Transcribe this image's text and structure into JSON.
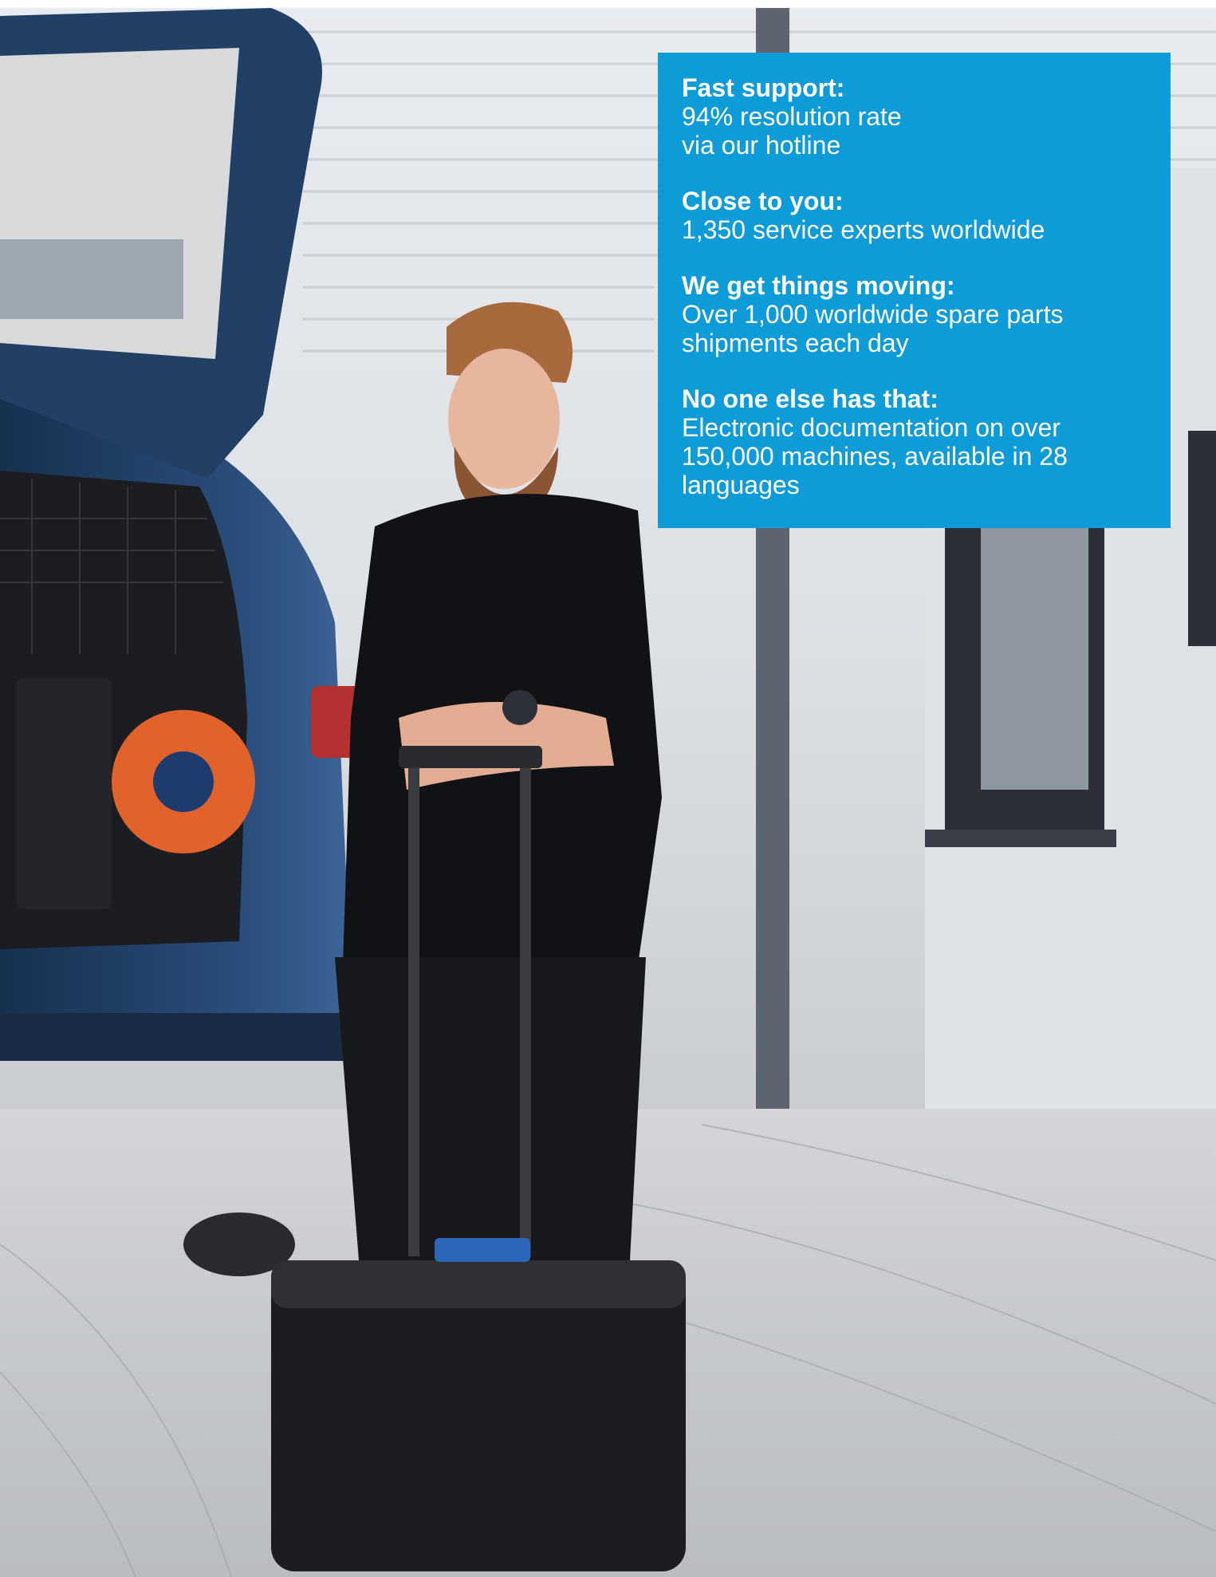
{
  "info_box": {
    "background_color": "#0d9cd8",
    "items": [
      {
        "heading": "Fast support:",
        "text": "94% resolution rate\nvia our hotline"
      },
      {
        "heading": "Close to you:",
        "text": "1,350 service experts worldwide"
      },
      {
        "heading": "We get things moving:",
        "text": "Over 1,000 worldwide spare parts\nshipments each day"
      },
      {
        "heading": "No one else has that:",
        "text": "Electronic documentation on over\n150,000 machines, available in 28\nlanguages"
      }
    ]
  },
  "colors": {
    "car_blue": "#1f3e66",
    "shirt_black": "#111216",
    "cable_orange": "#e1622b",
    "sky_white": "#f4f5f7"
  }
}
